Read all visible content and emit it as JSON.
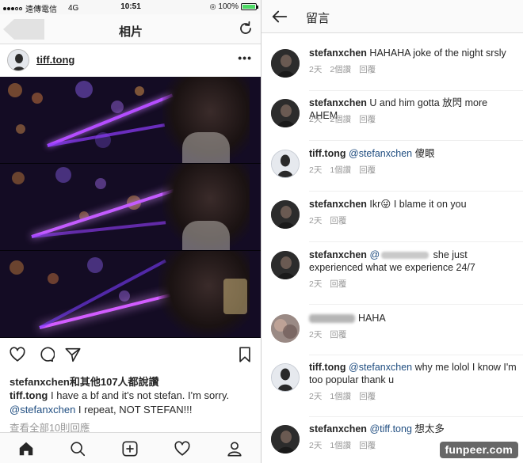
{
  "status_bar": {
    "carrier": "遠傳電信",
    "network": "4G",
    "time": "10:51",
    "battery": "100%",
    "battery_color": "#4cd964"
  },
  "post_view": {
    "title": "相片",
    "username": "tiff.tong",
    "likes_text": "stefanxchen和其他107人都說讚",
    "caption": {
      "author": "tiff.tong",
      "text_1": " I have a bf and it's not stefan. I'm sorry. ",
      "mention": "@stefanxchen",
      "text_2": " I repeat, NOT STEFAN!!!"
    },
    "view_all": "查看全部10則回應",
    "icons": [
      "back-button-shape",
      "refresh-icon",
      "more-icon",
      "heart-icon",
      "comment-icon",
      "share-icon",
      "bookmark-icon",
      "home-icon",
      "search-icon",
      "add-icon",
      "activity-heart-icon",
      "profile-icon"
    ]
  },
  "comments_view": {
    "title": "留言",
    "comments": [
      {
        "user": "stefanxchen",
        "text": " HAHAHA joke of the night srsly",
        "time": "2天",
        "likes": "2個讚",
        "reply": "回覆"
      },
      {
        "user": "stefanxchen",
        "text": " U and him gotta 放閃 more AHEM",
        "time": "2天",
        "likes": "2個讚",
        "reply": "回覆"
      },
      {
        "user": "tiff.tong",
        "mention": "@stefanxchen",
        "text": " 傻眼",
        "time": "2天",
        "likes": "1個讚",
        "reply": "回覆"
      },
      {
        "user": "stefanxchen",
        "text": " Ikr😜 I blame it on you",
        "time": "2天",
        "reply": "回覆"
      },
      {
        "user": "stefanxchen",
        "mention": "@",
        "text": " she just experienced what we experience 24/7",
        "time": "2天",
        "reply": "回覆"
      },
      {
        "text": "HAHA",
        "time": "2天",
        "reply": "回覆"
      },
      {
        "user": "tiff.tong",
        "mention": "@stefanxchen",
        "text": " why me lolol I know I'm too popular thank u",
        "time": "2天",
        "likes": "1個讚",
        "reply": "回覆"
      },
      {
        "user": "stefanxchen",
        "mention": "@tiff.tong",
        "text": " 想太多",
        "time": "2天",
        "likes": "1個讚",
        "reply": "回覆"
      }
    ]
  },
  "watermark": "funpeer.com",
  "colors": {
    "mention": "#1f4d80",
    "meta": "#9a9a9a",
    "accent_neon": "#9b3cff"
  }
}
